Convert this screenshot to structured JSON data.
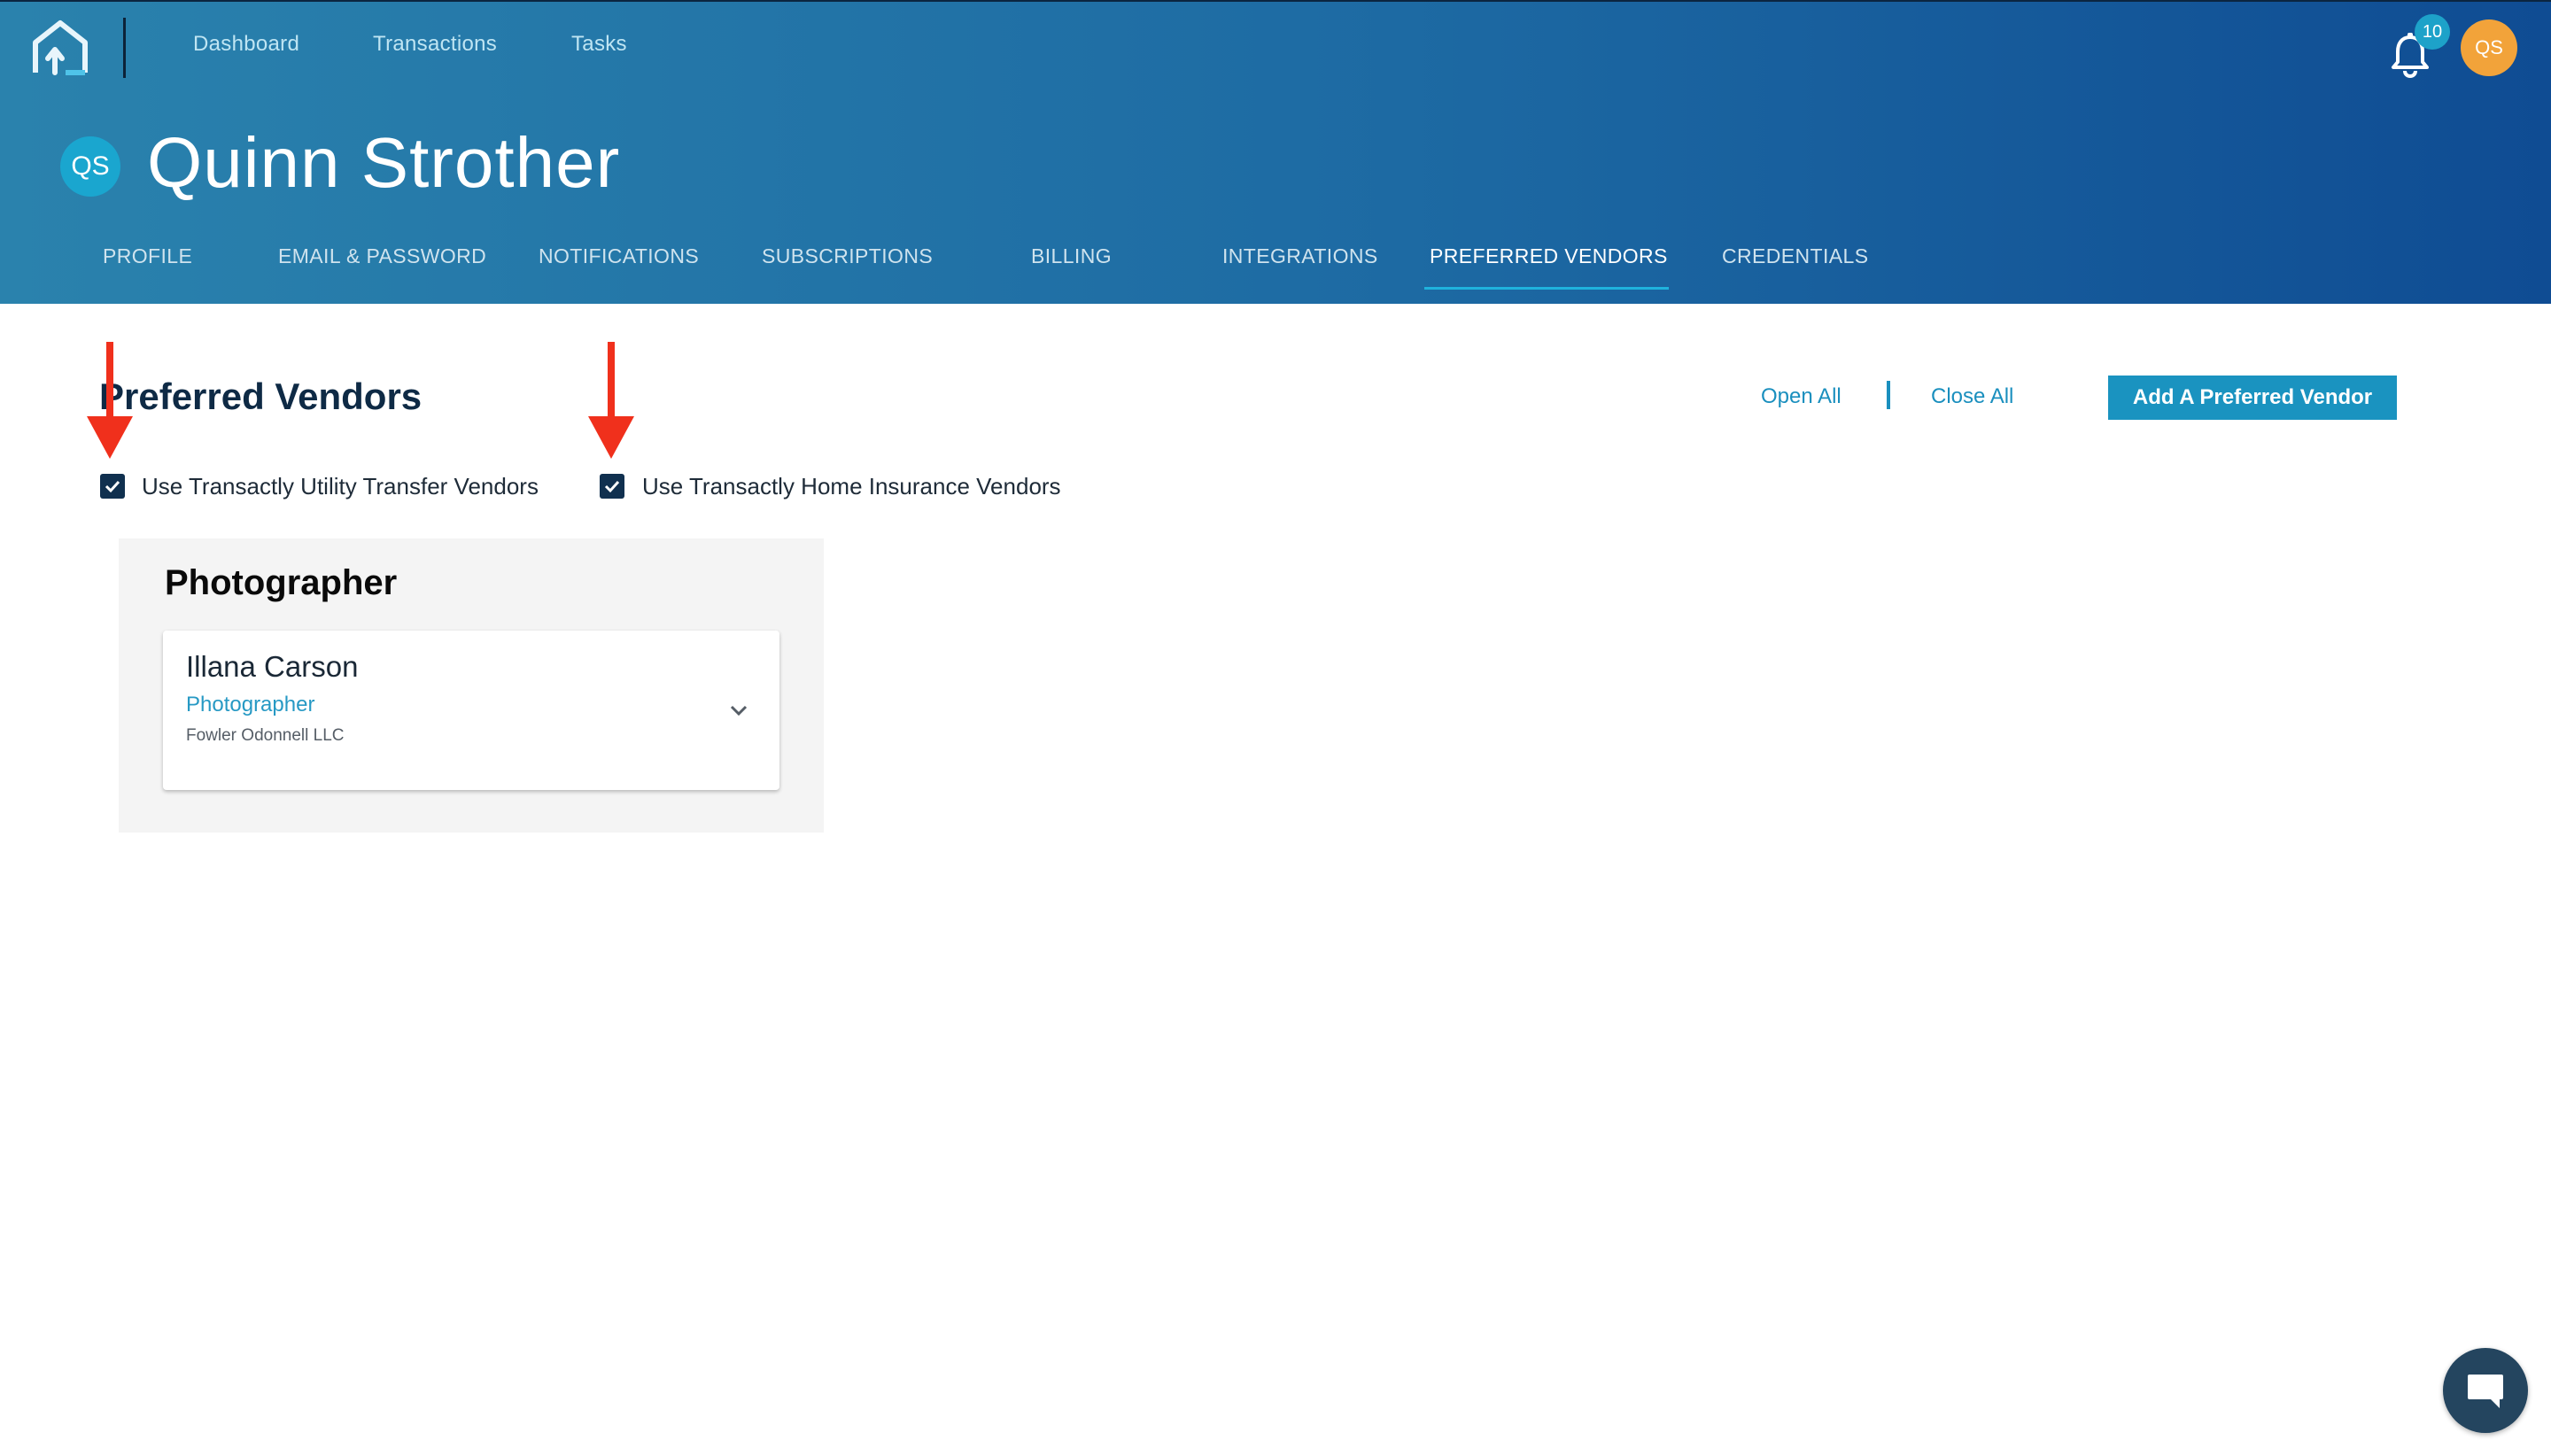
{
  "topnav": {
    "items": [
      {
        "label": "Dashboard"
      },
      {
        "label": "Transactions"
      },
      {
        "label": "Tasks"
      }
    ],
    "notifications_count": "10",
    "user_initials": "QS"
  },
  "profile": {
    "initials": "QS",
    "name": "Quinn Strother"
  },
  "tabs": [
    {
      "label": "PROFILE"
    },
    {
      "label": "EMAIL & PASSWORD"
    },
    {
      "label": "NOTIFICATIONS"
    },
    {
      "label": "SUBSCRIPTIONS"
    },
    {
      "label": "BILLING"
    },
    {
      "label": "INTEGRATIONS"
    },
    {
      "label": "PREFERRED VENDORS",
      "active": true
    },
    {
      "label": "CREDENTIALS"
    }
  ],
  "main": {
    "title": "Preferred Vendors",
    "open_all": "Open All",
    "close_all": "Close All",
    "add_button": "Add A Preferred Vendor",
    "options": [
      {
        "label": "Use Transactly Utility Transfer Vendors",
        "checked": true
      },
      {
        "label": "Use Transactly Home Insurance Vendors",
        "checked": true
      }
    ],
    "categories": [
      {
        "title": "Photographer",
        "vendors": [
          {
            "name": "Illana Carson",
            "type": "Photographer",
            "company": "Fowler Odonnell LLC"
          }
        ]
      }
    ]
  },
  "colors": {
    "header_start": "#2a82ad",
    "header_end": "#0f4c93",
    "accent": "#1a93c0",
    "annotation_arrow": "#f0301c",
    "avatar_orange": "#f2a33a"
  },
  "icons": [
    "home-logo-icon",
    "bell-icon",
    "check-icon",
    "chevron-down-icon",
    "chat-icon"
  ]
}
